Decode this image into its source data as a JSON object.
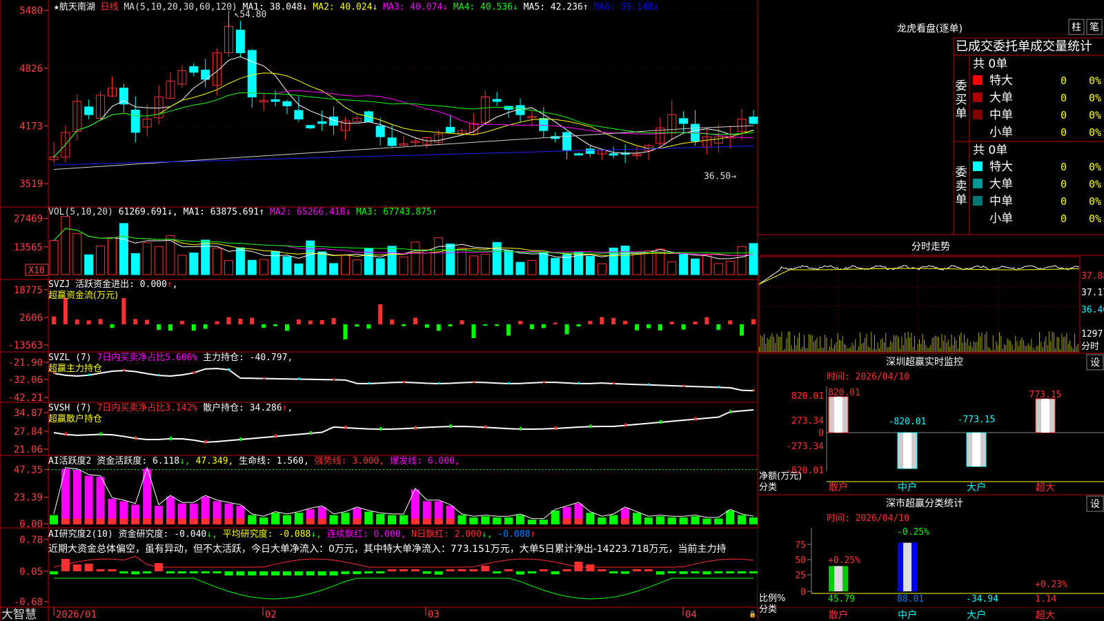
{
  "stock": {
    "name": "★航天南湖",
    "period": "日线"
  },
  "ma": {
    "label": "MA(5,10,20,30,60,120)",
    "items": [
      {
        "t": "MA1: 38.048",
        "arrow": "↓",
        "c": "#ffffff"
      },
      {
        "t": "MA2: 40.024",
        "arrow": "↓",
        "c": "#ffff00"
      },
      {
        "t": "MA3: 40.074",
        "arrow": "↓",
        "c": "#ff00ff"
      },
      {
        "t": "MA4: 40.536",
        "arrow": "↓",
        "c": "#00ff00"
      },
      {
        "t": "MA5: 42.236",
        "arrow": "↑",
        "c": "#ffffff"
      },
      {
        "t": "MA6: 39.148",
        "arrow": "↓",
        "c": "#0000ff"
      }
    ],
    "max_label": "54.80",
    "min_label": "36.50"
  },
  "price_axis": [
    "5480",
    "4826",
    "4173",
    "3519"
  ],
  "vol": {
    "label": "VOL(5,10,20)",
    "value": "61269.691",
    "v_arrow": "↓",
    "items": [
      {
        "t": "MA1: 63875.691",
        "arrow": "↑",
        "c": "#ffffff"
      },
      {
        "t": "MA2: 65266.418",
        "arrow": "↓",
        "c": "#ff00ff"
      },
      {
        "t": "MA3: 67743.875",
        "arrow": "↑",
        "c": "#00ff00"
      }
    ],
    "axis": [
      "27469",
      "13565"
    ],
    "unit": "X10"
  },
  "svzj": {
    "title": "SVZJ",
    "text": "活跃资金进出: 0.000",
    "arrow": "↑",
    "tail": ",",
    "sub": "超赢资金流(万元)",
    "axis": [
      "18775",
      "2606",
      "-13563"
    ]
  },
  "svzl": {
    "title": "SVZL (7)",
    "text1": "7日内买卖净占比5.606%",
    "text2": "主力持仓: -40.797,",
    "sub": "超赢主力持仓",
    "axis": [
      "-21.90",
      "-32.06",
      "-42.21"
    ]
  },
  "svsh": {
    "title": "SVSH (7)",
    "text1": "7日内买卖净占比3.142%",
    "text2": "散户持仓: 34.286",
    "arrow": "↑",
    "tail": ",",
    "sub": "超赢散户持仓",
    "axis": [
      "34.87",
      "27.84",
      "21.06"
    ]
  },
  "ai": {
    "title": "AI活跃度2",
    "t1": "资金活跃度: 6.118",
    "a1": "↓",
    "t2": "47.349",
    "t3": "生命线: 1.560,",
    "t4": "强势线: 3.000,",
    "t5": "爆发线: 6.000,",
    "axis": [
      "47.35",
      "23.39",
      "0.00"
    ]
  },
  "ai2": {
    "title": "AI研究度2(10)",
    "t1": "资金研究度: -0.040",
    "a1": "↓",
    "t2": "平均研究度: -0.088",
    "a2": "↓",
    "t3": "连续飘红: 0.000,",
    "t4": "N日飘红: 2.000",
    "a4": "↓",
    "t5": "-0.088",
    "a5": "↑",
    "comment": "近期大资金总体偏空，虽有异动，但不太活跃，今日大单净流入：0万元，其中特大单净流入：773.151万元，大单5日累计净出-14223.718万元，当前主力持",
    "axis": [
      "0.78",
      "0.05",
      "-0.68"
    ]
  },
  "dates": [
    "2026/01",
    "02",
    "03",
    "04"
  ],
  "brand": "大智慧",
  "right": {
    "dragon_title": "龙虎看盘(逐单)",
    "btn_zhu": "柱",
    "btn_bi": "笔",
    "header": "已成交委托单成交量统计",
    "buy": {
      "label": "委买单",
      "total": "共 0单",
      "rows": [
        {
          "name": "特大",
          "v": "0",
          "p": "0%",
          "c": "#ff0000"
        },
        {
          "name": "大单",
          "v": "0",
          "p": "0%",
          "c": "#aa0000"
        },
        {
          "name": "中单",
          "v": "0",
          "p": "0%",
          "c": "#800000"
        },
        {
          "name": "小单",
          "v": "0",
          "p": "0%",
          "c": ""
        }
      ]
    },
    "sell": {
      "label": "委卖单",
      "total": "共 0单",
      "rows": [
        {
          "name": "特大",
          "v": "0",
          "p": "0%",
          "c": "#00ffff"
        },
        {
          "name": "大单",
          "v": "0",
          "p": "0%",
          "c": "#009999"
        },
        {
          "name": "中单",
          "v": "0",
          "p": "0%",
          "c": "#007777"
        },
        {
          "name": "小单",
          "v": "0",
          "p": "0%",
          "c": ""
        }
      ]
    },
    "fenshi_title": "分时走势",
    "fenshi_axis": [
      "37.88",
      "37.17",
      "36.46",
      "1297"
    ],
    "fenshi_unit": "分时",
    "sz_title": "深圳超赢实时监控",
    "sz_btn": "设",
    "sz_time": "时间: 2026/04/10",
    "sz_axis": [
      "820.01",
      "273.34",
      "0",
      "-273.34",
      "-820.01"
    ],
    "sz_vals": [
      "820.01",
      "-820.01",
      "-773.15",
      "773.15"
    ],
    "sz_unit": "净额(万元)",
    "sz_fenlei": "分类",
    "cats": [
      "散户",
      "中户",
      "大户",
      "超大"
    ],
    "cls_title": "深市超赢分类统计",
    "cls_btn": "设",
    "cls_time": "时间: 2026/04/10",
    "cls_axis": [
      "75",
      "50",
      "25",
      "0"
    ],
    "cls_top": [
      "+0.25%",
      "-0.25%",
      "+0.23%"
    ],
    "cls_vals": [
      "45.79",
      "88.01",
      "-34.94",
      "1.14"
    ],
    "cls_unit": "比例%",
    "cls_fenlei": "分类"
  }
}
